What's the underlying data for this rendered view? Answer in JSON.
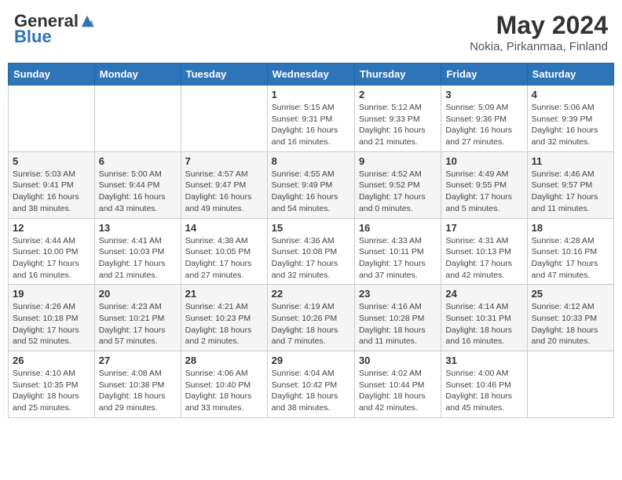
{
  "logo": {
    "general": "General",
    "blue": "Blue"
  },
  "title": {
    "month_year": "May 2024",
    "location": "Nokia, Pirkanmaa, Finland"
  },
  "days_of_week": [
    "Sunday",
    "Monday",
    "Tuesday",
    "Wednesday",
    "Thursday",
    "Friday",
    "Saturday"
  ],
  "weeks": [
    [
      {
        "num": "",
        "info": ""
      },
      {
        "num": "",
        "info": ""
      },
      {
        "num": "",
        "info": ""
      },
      {
        "num": "1",
        "info": "Sunrise: 5:15 AM\nSunset: 9:31 PM\nDaylight: 16 hours and 16 minutes."
      },
      {
        "num": "2",
        "info": "Sunrise: 5:12 AM\nSunset: 9:33 PM\nDaylight: 16 hours and 21 minutes."
      },
      {
        "num": "3",
        "info": "Sunrise: 5:09 AM\nSunset: 9:36 PM\nDaylight: 16 hours and 27 minutes."
      },
      {
        "num": "4",
        "info": "Sunrise: 5:06 AM\nSunset: 9:39 PM\nDaylight: 16 hours and 32 minutes."
      }
    ],
    [
      {
        "num": "5",
        "info": "Sunrise: 5:03 AM\nSunset: 9:41 PM\nDaylight: 16 hours and 38 minutes."
      },
      {
        "num": "6",
        "info": "Sunrise: 5:00 AM\nSunset: 9:44 PM\nDaylight: 16 hours and 43 minutes."
      },
      {
        "num": "7",
        "info": "Sunrise: 4:57 AM\nSunset: 9:47 PM\nDaylight: 16 hours and 49 minutes."
      },
      {
        "num": "8",
        "info": "Sunrise: 4:55 AM\nSunset: 9:49 PM\nDaylight: 16 hours and 54 minutes."
      },
      {
        "num": "9",
        "info": "Sunrise: 4:52 AM\nSunset: 9:52 PM\nDaylight: 17 hours and 0 minutes."
      },
      {
        "num": "10",
        "info": "Sunrise: 4:49 AM\nSunset: 9:55 PM\nDaylight: 17 hours and 5 minutes."
      },
      {
        "num": "11",
        "info": "Sunrise: 4:46 AM\nSunset: 9:57 PM\nDaylight: 17 hours and 11 minutes."
      }
    ],
    [
      {
        "num": "12",
        "info": "Sunrise: 4:44 AM\nSunset: 10:00 PM\nDaylight: 17 hours and 16 minutes."
      },
      {
        "num": "13",
        "info": "Sunrise: 4:41 AM\nSunset: 10:03 PM\nDaylight: 17 hours and 21 minutes."
      },
      {
        "num": "14",
        "info": "Sunrise: 4:38 AM\nSunset: 10:05 PM\nDaylight: 17 hours and 27 minutes."
      },
      {
        "num": "15",
        "info": "Sunrise: 4:36 AM\nSunset: 10:08 PM\nDaylight: 17 hours and 32 minutes."
      },
      {
        "num": "16",
        "info": "Sunrise: 4:33 AM\nSunset: 10:11 PM\nDaylight: 17 hours and 37 minutes."
      },
      {
        "num": "17",
        "info": "Sunrise: 4:31 AM\nSunset: 10:13 PM\nDaylight: 17 hours and 42 minutes."
      },
      {
        "num": "18",
        "info": "Sunrise: 4:28 AM\nSunset: 10:16 PM\nDaylight: 17 hours and 47 minutes."
      }
    ],
    [
      {
        "num": "19",
        "info": "Sunrise: 4:26 AM\nSunset: 10:18 PM\nDaylight: 17 hours and 52 minutes."
      },
      {
        "num": "20",
        "info": "Sunrise: 4:23 AM\nSunset: 10:21 PM\nDaylight: 17 hours and 57 minutes."
      },
      {
        "num": "21",
        "info": "Sunrise: 4:21 AM\nSunset: 10:23 PM\nDaylight: 18 hours and 2 minutes."
      },
      {
        "num": "22",
        "info": "Sunrise: 4:19 AM\nSunset: 10:26 PM\nDaylight: 18 hours and 7 minutes."
      },
      {
        "num": "23",
        "info": "Sunrise: 4:16 AM\nSunset: 10:28 PM\nDaylight: 18 hours and 11 minutes."
      },
      {
        "num": "24",
        "info": "Sunrise: 4:14 AM\nSunset: 10:31 PM\nDaylight: 18 hours and 16 minutes."
      },
      {
        "num": "25",
        "info": "Sunrise: 4:12 AM\nSunset: 10:33 PM\nDaylight: 18 hours and 20 minutes."
      }
    ],
    [
      {
        "num": "26",
        "info": "Sunrise: 4:10 AM\nSunset: 10:35 PM\nDaylight: 18 hours and 25 minutes."
      },
      {
        "num": "27",
        "info": "Sunrise: 4:08 AM\nSunset: 10:38 PM\nDaylight: 18 hours and 29 minutes."
      },
      {
        "num": "28",
        "info": "Sunrise: 4:06 AM\nSunset: 10:40 PM\nDaylight: 18 hours and 33 minutes."
      },
      {
        "num": "29",
        "info": "Sunrise: 4:04 AM\nSunset: 10:42 PM\nDaylight: 18 hours and 38 minutes."
      },
      {
        "num": "30",
        "info": "Sunrise: 4:02 AM\nSunset: 10:44 PM\nDaylight: 18 hours and 42 minutes."
      },
      {
        "num": "31",
        "info": "Sunrise: 4:00 AM\nSunset: 10:46 PM\nDaylight: 18 hours and 45 minutes."
      },
      {
        "num": "",
        "info": ""
      }
    ]
  ]
}
